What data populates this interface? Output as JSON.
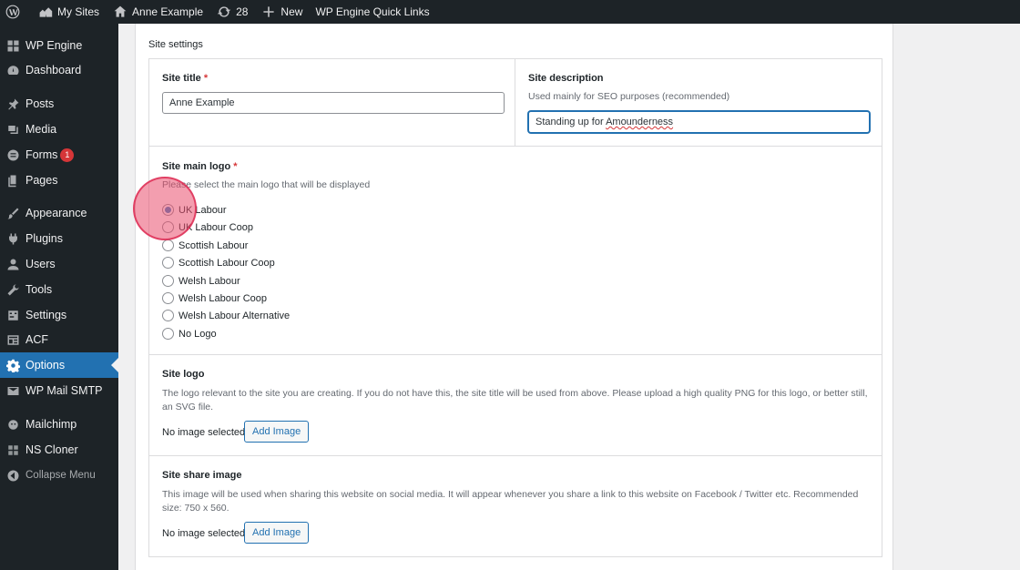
{
  "adminbar": {
    "wp_logo": "wordpress-icon",
    "my_sites": "My Sites",
    "site_name": "Anne Example",
    "updates_count": "28",
    "new_label": "New",
    "quick_links": "WP Engine Quick Links"
  },
  "sidebar": {
    "items": [
      {
        "label": "WP Engine",
        "icon": "grid-icon"
      },
      {
        "label": "Dashboard",
        "icon": "dashboard-icon"
      },
      {
        "label": "Posts",
        "icon": "pin-icon"
      },
      {
        "label": "Media",
        "icon": "media-icon"
      },
      {
        "label": "Forms",
        "icon": "forms-icon",
        "badge": "1"
      },
      {
        "label": "Pages",
        "icon": "pages-icon"
      },
      {
        "label": "Appearance",
        "icon": "brush-icon"
      },
      {
        "label": "Plugins",
        "icon": "plug-icon"
      },
      {
        "label": "Users",
        "icon": "user-icon"
      },
      {
        "label": "Tools",
        "icon": "wrench-icon"
      },
      {
        "label": "Settings",
        "icon": "settings-icon"
      },
      {
        "label": "ACF",
        "icon": "acf-icon"
      },
      {
        "label": "Options",
        "icon": "gear-icon",
        "active": true
      },
      {
        "label": "WP Mail SMTP",
        "icon": "mail-icon"
      },
      {
        "label": "Mailchimp",
        "icon": "mailchimp-icon"
      },
      {
        "label": "NS Cloner",
        "icon": "cloner-icon"
      },
      {
        "label": "Collapse Menu",
        "icon": "collapse-icon"
      }
    ]
  },
  "panel": {
    "title": "Site settings",
    "site_title": {
      "label": "Site title",
      "required": "*",
      "value": "Anne Example"
    },
    "site_description": {
      "label": "Site description",
      "desc": "Used mainly for SEO purposes (recommended)",
      "value_prefix": "Standing up for ",
      "value_misspelled": "Amounderness"
    },
    "main_logo": {
      "label": "Site main logo",
      "required": "*",
      "desc": "Please select the main logo that will be displayed",
      "options": [
        "UK Labour",
        "UK Labour Coop",
        "Scottish Labour",
        "Scottish Labour Coop",
        "Welsh Labour",
        "Welsh Labour Coop",
        "Welsh Labour Alternative",
        "No Logo"
      ],
      "selected": "UK Labour"
    },
    "site_logo": {
      "label": "Site logo",
      "desc": "The logo relevant to the site you are creating. If you do not have this, the site title will be used from above. Please upload a high quality PNG for this logo, or better still, an SVG file.",
      "no_image": "No image selected",
      "button": "Add Image"
    },
    "share_image": {
      "label": "Site share image",
      "desc": "This image will be used when sharing this website on social media. It will appear whenever you share a link to this website on Facebook / Twitter etc. Recommended size: 750 x 560.",
      "no_image": "No image selected",
      "button": "Add Image"
    }
  },
  "colors": {
    "admin_bg": "#1d2327",
    "accent": "#2271b1",
    "required": "#d63638",
    "click_indicator": "#ea4f6e"
  }
}
